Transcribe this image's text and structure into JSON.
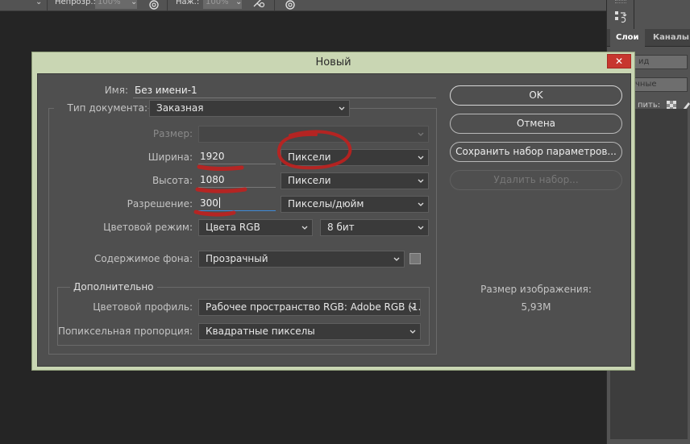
{
  "options_bar": {
    "opacity_label": "Непрозр.:",
    "opacity_value": "100%",
    "flow_label": "Наж.:",
    "flow_value": "100%"
  },
  "right_panel": {
    "tabs": [
      {
        "label": "Слои",
        "active": true
      },
      {
        "label": "Каналы",
        "active": false
      }
    ],
    "rows": [
      "ид",
      "чные",
      "пить:"
    ]
  },
  "dialog": {
    "title": "Новый",
    "name_label": "Имя:",
    "name_value": "Без имени-1",
    "doc_type_label": "Тип документа:",
    "doc_type_value": "Заказная",
    "size_label": "Размер:",
    "size_value": "",
    "width_label": "Ширина:",
    "width_value": "1920",
    "width_unit": "Пиксели",
    "height_label": "Высота:",
    "height_value": "1080",
    "height_unit": "Пиксели",
    "resolution_label": "Разрешение:",
    "resolution_value": "300",
    "resolution_unit": "Пикселы/дюйм",
    "color_mode_label": "Цветовой режим:",
    "color_mode_value": "Цвета RGB",
    "bit_depth_value": "8 бит",
    "background_label": "Содержимое фона:",
    "background_value": "Прозрачный",
    "advanced_title": "Дополнительно",
    "color_profile_label": "Цветовой профиль:",
    "color_profile_value": "Рабочее пространство RGB:  Adobe RGB (1...",
    "pixel_aspect_label": "Попиксельная пропорция:",
    "pixel_aspect_value": "Квадратные пикселы",
    "buttons": {
      "ok": "OK",
      "cancel": "Отмена",
      "save_preset": "Сохранить набор параметров...",
      "delete_preset": "Удалить набор..."
    },
    "image_size_label": "Размер изображения:",
    "image_size_value": "5,93M"
  },
  "colors": {
    "dialog_frame": "#c9d6b3",
    "dialog_body": "#4f4f4f",
    "close_button": "#c7372f",
    "annotation": "#c0201e",
    "focus": "#3f8ad8"
  }
}
